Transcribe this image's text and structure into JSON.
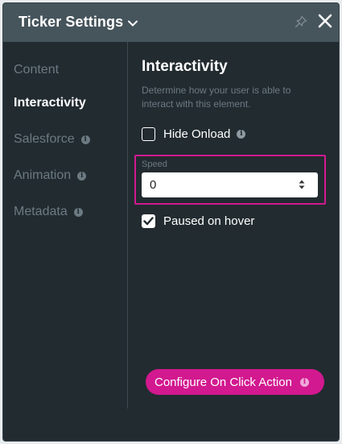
{
  "header": {
    "title": "Ticker Settings",
    "icons": [
      "chevron-down-icon",
      "pin-icon",
      "close-icon"
    ]
  },
  "sidebar": {
    "items": [
      {
        "label": "Content",
        "active": false,
        "info": false
      },
      {
        "label": "Interactivity",
        "active": true,
        "info": false
      },
      {
        "label": "Salesforce",
        "active": false,
        "info": true
      },
      {
        "label": "Animation",
        "active": false,
        "info": true
      },
      {
        "label": "Metadata",
        "active": false,
        "info": true
      }
    ]
  },
  "main": {
    "title": "Interactivity",
    "description": "Determine how your user is able to interact with this element.",
    "hide_onload": {
      "label": "Hide Onload",
      "checked": false
    },
    "speed": {
      "label": "Speed",
      "value": "0"
    },
    "paused_on_hover": {
      "label": "Paused on hover",
      "checked": true
    },
    "action_button": {
      "label": "Configure On Click Action"
    }
  },
  "colors": {
    "panel_bg": "#222b30",
    "header_bg": "#46545b",
    "accent": "#d2198f",
    "muted_text": "#6c7a82"
  }
}
